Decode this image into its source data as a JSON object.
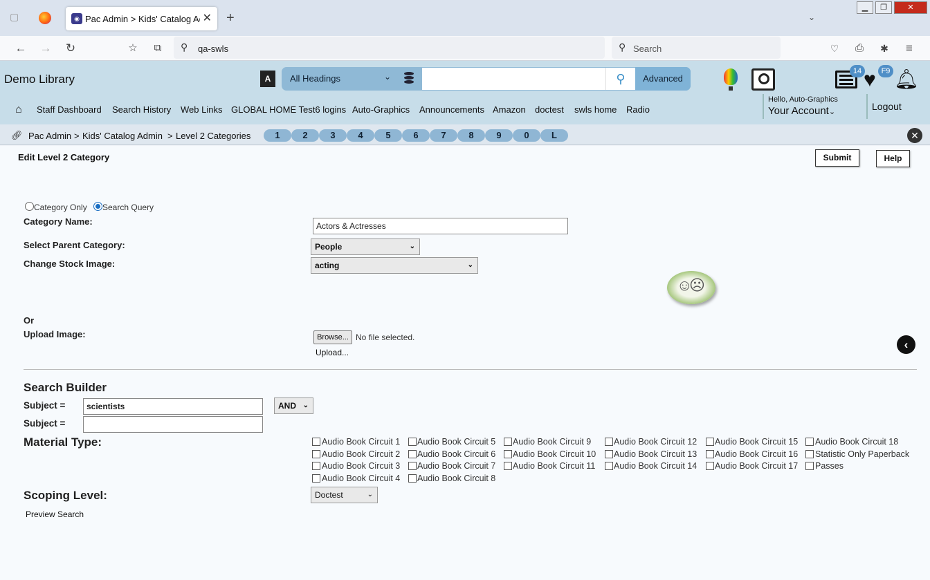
{
  "browser": {
    "tab_title": "Pac Admin > Kids' Catalog Adm",
    "url": "qa-swls",
    "search_placeholder": "Search"
  },
  "app": {
    "library_name": "Demo Library",
    "search_scope": "All Headings",
    "advanced_label": "Advanced",
    "list_count": "14",
    "favorites_label": "F9",
    "menu": [
      "Staff Dashboard",
      "Search History",
      "Web Links",
      "GLOBAL HOME Test6 logins",
      "Auto-Graphics",
      "Announcements",
      "Amazon",
      "doctest",
      "swls home",
      "Radio"
    ],
    "hello": "Hello, Auto-Graphics",
    "your_account": "Your Account",
    "logout": "Logout"
  },
  "breadcrumb": {
    "items": [
      "Pac Admin",
      "Kids' Catalog Admin",
      "Level 2 Categories"
    ],
    "separator": ">",
    "hotkeys": [
      "1",
      "2",
      "3",
      "4",
      "5",
      "6",
      "7",
      "8",
      "9",
      "0",
      "L"
    ]
  },
  "form": {
    "title": "Edit Level 2 Category",
    "submit_label": "Submit",
    "help_label": "Help",
    "radio_category_only": "Category Only",
    "radio_search_query": "Search Query",
    "category_name_label": "Category Name:",
    "category_name_value": "Actors & Actresses",
    "parent_label": "Select Parent Category:",
    "parent_value": "People",
    "stock_image_label": "Change Stock Image:",
    "stock_image_value": "acting",
    "or_label": "Or",
    "upload_label": "Upload Image:",
    "browse_label": "Browse...",
    "file_status": "No file selected.",
    "upload_link": "Upload...",
    "search_builder_title": "Search Builder",
    "subject_label": "Subject =",
    "subject1_value": "scientists",
    "subject2_value": "",
    "operator_value": "AND",
    "material_type_label": "Material Type:",
    "material_types": [
      "Audio Book Circuit 1",
      "Audio Book Circuit 2",
      "Audio Book Circuit 3",
      "Audio Book Circuit 4",
      "Audio Book Circuit 5",
      "Audio Book Circuit 6",
      "Audio Book Circuit 7",
      "Audio Book Circuit 8",
      "Audio Book Circuit 9",
      "Audio Book Circuit 10",
      "Audio Book Circuit 11",
      "Audio Book Circuit 12",
      "Audio Book Circuit 13",
      "Audio Book Circuit 14",
      "Audio Book Circuit 15",
      "Audio Book Circuit 16",
      "Audio Book Circuit 17",
      "Audio Book Circuit 18",
      "Statistic Only Paperback",
      "Passes"
    ],
    "scoping_label": "Scoping Level:",
    "scoping_value": "Doctest",
    "preview_label": "Preview Search"
  }
}
